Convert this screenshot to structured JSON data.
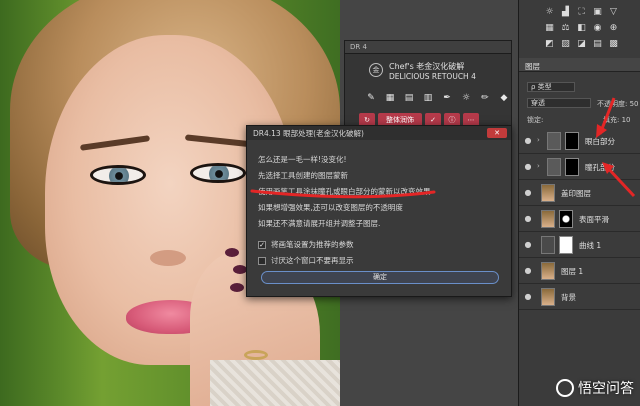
{
  "dr_panel": {
    "title": "DR 4",
    "brand_line1": "Chef's 老金汉化破解",
    "brand_line2": "DELICIOUS RETOUCH 4",
    "logo_glyph": "金",
    "tool_icons": [
      "brush-icon",
      "eraser-icon",
      "film-icon",
      "grid-icon",
      "pen-icon",
      "sun-icon",
      "pencil-icon",
      "diamond-icon"
    ],
    "button_row": [
      "↻",
      "整体润饰",
      "✓",
      "ⓘ",
      "⋯"
    ]
  },
  "dialog": {
    "title": "DR4.13 眼部处理(老金汉化破解)",
    "close_label": "✕",
    "messages": [
      "怎么还是一毛一样!没变化!",
      "先选择工具创建的图层蒙新",
      "使用画笔工具涂抹瞳孔或眼白部分的蒙新以改变效果",
      "如果想增强效果,还可以改变图层的不透明度",
      "如果还不满意请展开组并调整子图层."
    ],
    "checkbox_1": {
      "label": "将画笔设置为推荐的参数",
      "checked": "✓"
    },
    "checkbox_2": {
      "label": "讨厌这个窗口不要再显示",
      "checked": ""
    },
    "ok_label": "确定"
  },
  "layers_panel": {
    "tab_label": "图层",
    "filter_label": "ρ 类型",
    "blend_mode": "穿透",
    "opacity_label": "不透明度: 50",
    "lock_label": "锁定:",
    "fill_label": "填充: 10",
    "layers": [
      {
        "name": "眼白部分",
        "kind": "group",
        "arrow": "›"
      },
      {
        "name": "瞳孔部分",
        "kind": "group",
        "arrow": "›"
      },
      {
        "name": "盖印图层",
        "kind": "pixel"
      },
      {
        "name": "表面平滑",
        "kind": "masked"
      },
      {
        "name": "曲线 1",
        "kind": "adjustment"
      },
      {
        "name": "图层 1",
        "kind": "pixel"
      },
      {
        "name": "背景",
        "kind": "pixel"
      }
    ],
    "eye_glyph": "●"
  },
  "watermark": {
    "text": "悟空问答"
  },
  "colors": {
    "annotation_red": "#e32626",
    "accent_blue": "#6a8fc9"
  }
}
